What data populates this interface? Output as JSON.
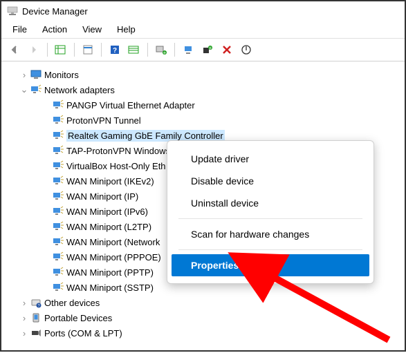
{
  "window": {
    "title": "Device Manager"
  },
  "menubar": {
    "file": "File",
    "action": "Action",
    "view": "View",
    "help": "Help"
  },
  "tree": {
    "monitors": {
      "label": "Monitors"
    },
    "network": {
      "label": "Network adapters",
      "items": [
        "PANGP Virtual Ethernet Adapter",
        "ProtonVPN Tunnel",
        "Realtek Gaming GbE Family Controller",
        "TAP-ProtonVPN Windows",
        "VirtualBox Host-Only Eth",
        "WAN Miniport (IKEv2)",
        "WAN Miniport (IP)",
        "WAN Miniport (IPv6)",
        "WAN Miniport (L2TP)",
        "WAN Miniport (Network",
        "WAN Miniport (PPPOE)",
        "WAN Miniport (PPTP)",
        "WAN Miniport (SSTP)"
      ]
    },
    "other": {
      "label": "Other devices"
    },
    "portable": {
      "label": "Portable Devices"
    },
    "ports": {
      "label": "Ports (COM & LPT)"
    }
  },
  "context_menu": {
    "update": "Update driver",
    "disable": "Disable device",
    "uninstall": "Uninstall device",
    "scan": "Scan for hardware changes",
    "properties": "Properties"
  }
}
